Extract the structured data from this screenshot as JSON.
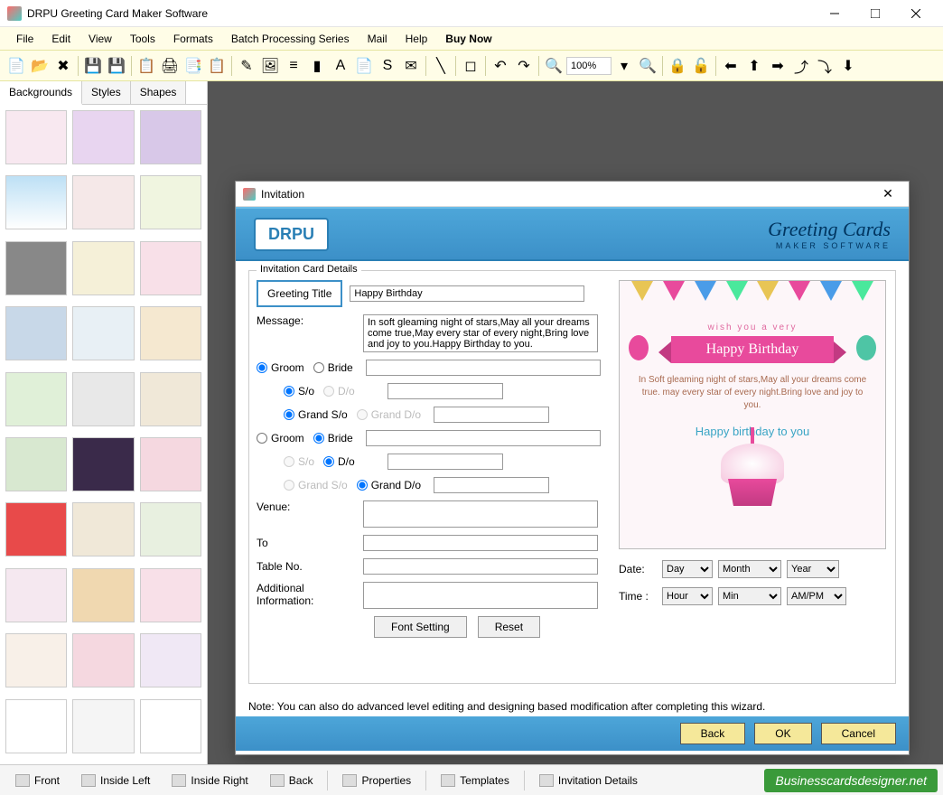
{
  "titlebar": {
    "title": "DRPU Greeting Card Maker Software"
  },
  "menubar": [
    "File",
    "Edit",
    "View",
    "Tools",
    "Formats",
    "Batch Processing Series",
    "Mail",
    "Help",
    "Buy Now"
  ],
  "toolbar": {
    "zoom": "100%"
  },
  "sidebar": {
    "tabs": [
      "Backgrounds",
      "Styles",
      "Shapes"
    ]
  },
  "dialog": {
    "title": "Invitation",
    "logo": "DRPU",
    "brand_cursive": "Greeting Cards",
    "brand_sub": "MAKER SOFTWARE",
    "group": "Invitation Card Details",
    "fields": {
      "greeting_title_lbl": "Greeting Title",
      "greeting_title_val": "Happy Birthday",
      "message_lbl": "Message:",
      "message_val": "In soft gleaming night of stars,May all your dreams come true,May every star of every night,Bring love and joy to you.Happy Birthday to you.",
      "groom": "Groom",
      "bride": "Bride",
      "so": "S/o",
      "do": "D/o",
      "grandso": "Grand S/o",
      "granddo": "Grand D/o",
      "venue": "Venue:",
      "to": "To",
      "tableno": "Table No.",
      "addinfo": "Additional Information:",
      "fontsetting": "Font Setting",
      "reset": "Reset"
    },
    "preview": {
      "wish": "wish you a very",
      "ribbon": "Happy Birthday",
      "msg": "In Soft gleaming night of stars,May all your dreams come true. may every star of every night.Bring love and joy to you.",
      "hb2": "Happy birthday to you"
    },
    "date": {
      "date_lbl": "Date:",
      "time_lbl": "Time :",
      "day": "Day",
      "month": "Month",
      "year": "Year",
      "hour": "Hour",
      "min": "Min",
      "ampm": "AM/PM"
    },
    "note": "Note: You can also do advanced level editing and designing based modification after completing this wizard.",
    "back": "Back",
    "ok": "OK",
    "cancel": "Cancel"
  },
  "bottomtabs": [
    "Front",
    "Inside Left",
    "Inside Right",
    "Back",
    "Properties",
    "Templates",
    "Invitation Details"
  ],
  "watermark": "Businesscardsdesigner.net"
}
